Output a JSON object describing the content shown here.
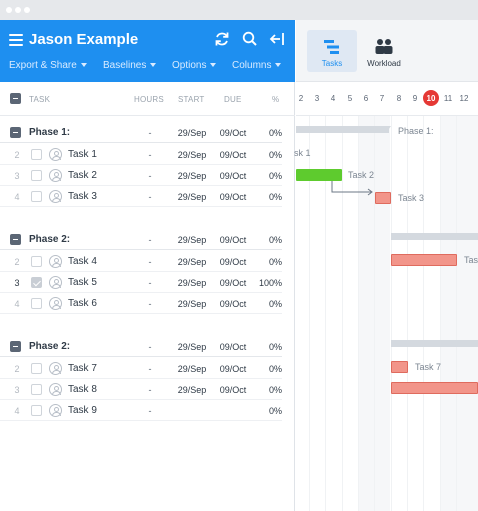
{
  "app": {
    "title": "Jason Example"
  },
  "header": {
    "menu_items": [
      {
        "label": "Export & Share"
      },
      {
        "label": "Baselines"
      },
      {
        "label": "Options"
      },
      {
        "label": "Columns"
      }
    ]
  },
  "columns": {
    "task": "TASK",
    "hours": "HOURS",
    "start": "START",
    "due": "DUE",
    "pct": "%"
  },
  "view_toggle": {
    "tasks_label": "Tasks",
    "workload_label": "Workload"
  },
  "timeline": {
    "days": [
      "2",
      "3",
      "4",
      "5",
      "6",
      "7",
      "8",
      "9",
      "10",
      "11",
      "12"
    ],
    "today": "10"
  },
  "groups": [
    {
      "phase": {
        "name": "Phase 1:",
        "hours": "-",
        "start": "29/Sep",
        "due": "09/Oct",
        "pct": "0%"
      },
      "tasks": [
        {
          "num": "2",
          "name": "Task 1",
          "hours": "-",
          "start": "29/Sep",
          "due": "09/Oct",
          "pct": "0%",
          "checked": false
        },
        {
          "num": "3",
          "name": "Task 2",
          "hours": "-",
          "start": "29/Sep",
          "due": "09/Oct",
          "pct": "0%",
          "checked": false
        },
        {
          "num": "4",
          "name": "Task 3",
          "hours": "-",
          "start": "29/Sep",
          "due": "09/Oct",
          "pct": "0%",
          "checked": false
        }
      ]
    },
    {
      "phase": {
        "name": "Phase 2:",
        "hours": "-",
        "start": "29/Sep",
        "due": "09/Oct",
        "pct": "0%"
      },
      "tasks": [
        {
          "num": "2",
          "name": "Task 4",
          "hours": "-",
          "start": "29/Sep",
          "due": "09/Oct",
          "pct": "0%",
          "checked": false
        },
        {
          "num": "3",
          "name": "Task 5",
          "hours": "-",
          "start": "29/Sep",
          "due": "09/Oct",
          "pct": "100%",
          "checked": true
        },
        {
          "num": "4",
          "name": "Task 6",
          "hours": "-",
          "start": "29/Sep",
          "due": "09/Oct",
          "pct": "0%",
          "checked": false
        }
      ]
    },
    {
      "phase": {
        "name": "Phase 2:",
        "hours": "-",
        "start": "29/Sep",
        "due": "09/Oct",
        "pct": "0%"
      },
      "tasks": [
        {
          "num": "2",
          "name": "Task 7",
          "hours": "-",
          "start": "29/Sep",
          "due": "09/Oct",
          "pct": "0%",
          "checked": false
        },
        {
          "num": "3",
          "name": "Task 8",
          "hours": "-",
          "start": "29/Sep",
          "due": "09/Oct",
          "pct": "0%",
          "checked": false
        },
        {
          "num": "4",
          "name": "Task 9",
          "hours": "-",
          "start": "",
          "due": "",
          "pct": "0%",
          "checked": false
        }
      ]
    }
  ],
  "gantt_labels": {
    "phase1": "Phase 1:",
    "task1_partial": "sk 1",
    "task2": "Task 2",
    "task3": "Task 3",
    "task4_partial": "Tas",
    "task7": "Task 7"
  },
  "colors": {
    "header_blue": "#1e8ff0",
    "green_bar": "#5ecb2e",
    "red_bar": "#f2958a",
    "today_red": "#e53935"
  }
}
